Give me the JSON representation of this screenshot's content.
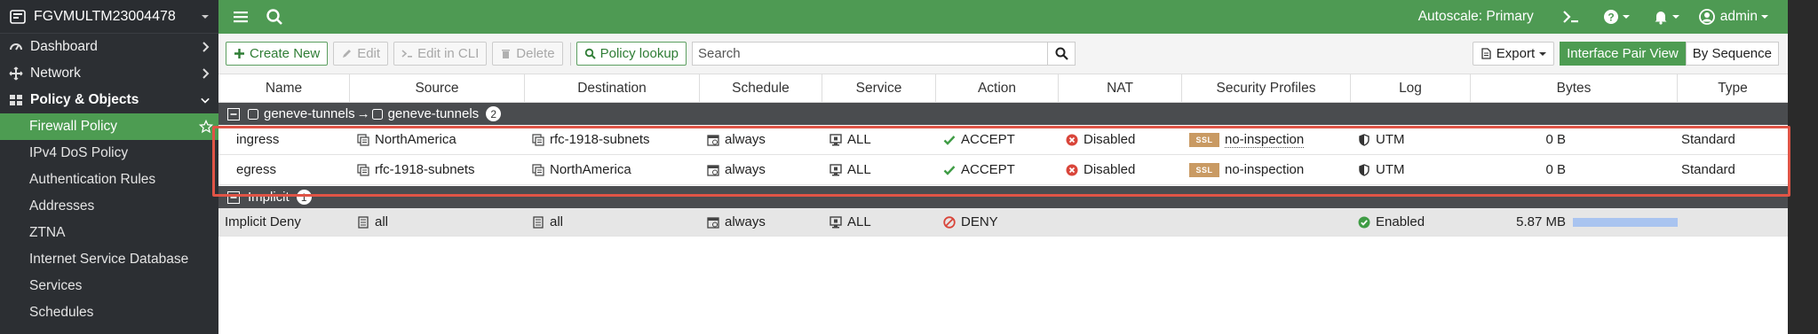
{
  "brand": {
    "device_name": "FGVMULTM23004478"
  },
  "sidebar": {
    "items": [
      {
        "label": "Dashboard",
        "icon": "dashboard-icon"
      },
      {
        "label": "Network",
        "icon": "network-icon"
      },
      {
        "label": "Policy & Objects",
        "icon": "policy-icon",
        "expanded": true
      }
    ],
    "subitems": [
      {
        "label": "Firewall Policy",
        "active": true
      },
      {
        "label": "IPv4 DoS Policy"
      },
      {
        "label": "Authentication Rules"
      },
      {
        "label": "Addresses"
      },
      {
        "label": "ZTNA"
      },
      {
        "label": "Internet Service Database"
      },
      {
        "label": "Services"
      },
      {
        "label": "Schedules"
      }
    ]
  },
  "topbar": {
    "autoscale": "Autoscale:  Primary",
    "user": "admin"
  },
  "toolbar": {
    "create_new": "Create New",
    "edit": "Edit",
    "edit_cli": "Edit in CLI",
    "delete": "Delete",
    "policy_lookup": "Policy lookup",
    "search_placeholder": "Search",
    "export": "Export",
    "view_interface_pair": "Interface Pair View",
    "view_by_sequence": "By Sequence"
  },
  "table": {
    "columns": [
      "Name",
      "Source",
      "Destination",
      "Schedule",
      "Service",
      "Action",
      "NAT",
      "Security Profiles",
      "Log",
      "Bytes",
      "Type"
    ],
    "group1": {
      "from": "geneve-tunnels",
      "arrow": "→",
      "to": "geneve-tunnels",
      "count": "2"
    },
    "rows": [
      {
        "name": "ingress",
        "source": "NorthAmerica",
        "destination": "rfc-1918-subnets",
        "schedule": "always",
        "service": "ALL",
        "action": "ACCEPT",
        "nat": "Disabled",
        "ssl": "SSL",
        "profile": "no-inspection",
        "log": "UTM",
        "bytes": "0 B",
        "type": "Standard"
      },
      {
        "name": "egress",
        "source": "rfc-1918-subnets",
        "destination": "NorthAmerica",
        "schedule": "always",
        "service": "ALL",
        "action": "ACCEPT",
        "nat": "Disabled",
        "ssl": "SSL",
        "profile": "no-inspection",
        "log": "UTM",
        "bytes": "0 B",
        "type": "Standard"
      }
    ],
    "group2": {
      "label": "Implicit",
      "count": "1"
    },
    "implicit_row": {
      "name": "Implicit Deny",
      "source": "all",
      "destination": "all",
      "schedule": "always",
      "service": "ALL",
      "action": "DENY",
      "log": "Enabled",
      "bytes": "5.87 MB",
      "bytes_bar_fraction": 1.0
    }
  },
  "colors": {
    "topbar": "#4e9a53",
    "sidebar": "#2c2f33",
    "active": "#4d9c52",
    "accept": "#3f9c45",
    "disabled_nat": "#d9453a",
    "deny": "#d9453a",
    "highlight": "#e05446",
    "bytes_bar": "#a9c4f0"
  }
}
